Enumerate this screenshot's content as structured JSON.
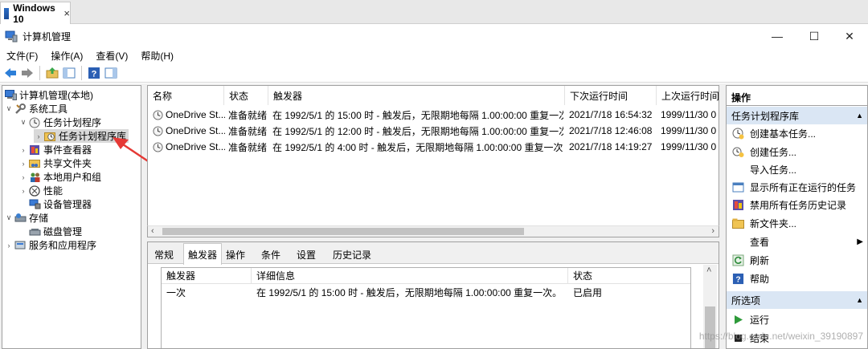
{
  "browser_tab": {
    "label": "Windows 10",
    "close": "×"
  },
  "window": {
    "title": "计算机管理",
    "minimize": "—",
    "maximize": "☐",
    "close": "✕"
  },
  "menu": [
    {
      "label": "文件(F)"
    },
    {
      "label": "操作(A)"
    },
    {
      "label": "查看(V)"
    },
    {
      "label": "帮助(H)"
    }
  ],
  "tree": {
    "root": "计算机管理(本地)",
    "items": [
      {
        "label": "系统工具",
        "expander": "∨"
      },
      {
        "label": "任务计划程序",
        "expander": "∨"
      },
      {
        "label": "任务计划程序库",
        "expander": "›"
      },
      {
        "label": "事件查看器",
        "expander": "›"
      },
      {
        "label": "共享文件夹",
        "expander": "›"
      },
      {
        "label": "本地用户和组",
        "expander": "›"
      },
      {
        "label": "性能",
        "expander": "›"
      },
      {
        "label": "设备管理器",
        "expander": ""
      },
      {
        "label": "存储",
        "expander": "∨"
      },
      {
        "label": "磁盘管理",
        "expander": ""
      },
      {
        "label": "服务和应用程序",
        "expander": "›"
      }
    ]
  },
  "tasks": {
    "columns": [
      "名称",
      "状态",
      "触发器",
      "下次运行时间",
      "上次运行时间"
    ],
    "rows": [
      {
        "name": "OneDrive St...",
        "status": "准备就绪",
        "trigger": "在 1992/5/1 的 15:00 时 - 触发后，无限期地每隔 1.00:00:00 重复一次。",
        "next": "2021/7/18 16:54:32",
        "last": "1999/11/30 0"
      },
      {
        "name": "OneDrive St...",
        "status": "准备就绪",
        "trigger": "在 1992/5/1 的 12:00 时 - 触发后，无限期地每隔 1.00:00:00 重复一次。",
        "next": "2021/7/18 12:46:08",
        "last": "1999/11/30 0"
      },
      {
        "name": "OneDrive St...",
        "status": "准备就绪",
        "trigger": "在 1992/5/1 的 4:00 时 - 触发后，无限期地每隔 1.00:00:00 重复一次。",
        "next": "2021/7/18 14:19:27",
        "last": "1999/11/30 0"
      }
    ],
    "scroll_left": "‹",
    "scroll_right": "›"
  },
  "detail": {
    "tabs": [
      "常规",
      "触发器",
      "操作",
      "条件",
      "设置",
      "历史记录"
    ],
    "active_tab": "触发器",
    "columns": [
      "触发器",
      "详细信息",
      "状态"
    ],
    "rows": [
      {
        "trigger": "一次",
        "details": "在 1992/5/1 的 15:00 时 - 触发后，无限期地每隔 1.00:00:00 重复一次。",
        "status": "已启用"
      }
    ],
    "scroll_up": "˄"
  },
  "actions": {
    "title": "操作",
    "section1": {
      "title": "任务计划程序库",
      "caret": "▲"
    },
    "items1": [
      {
        "label": "创建基本任务..."
      },
      {
        "label": "创建任务..."
      },
      {
        "label": "导入任务..."
      },
      {
        "label": "显示所有正在运行的任务"
      },
      {
        "label": "禁用所有任务历史记录"
      },
      {
        "label": "新文件夹..."
      },
      {
        "label": "查看",
        "arrow": "▶"
      },
      {
        "label": "刷新"
      },
      {
        "label": "帮助"
      }
    ],
    "section2": {
      "title": "所选项",
      "caret": "▲"
    },
    "items2": [
      {
        "label": "运行"
      },
      {
        "label": "结束"
      }
    ]
  },
  "watermark": "https://blog.csdn.net/weixin_39190897",
  "colors": {
    "accent_arrow": "#e53935",
    "section_header": "#dae6f4",
    "selection": "#d9d9d9"
  }
}
